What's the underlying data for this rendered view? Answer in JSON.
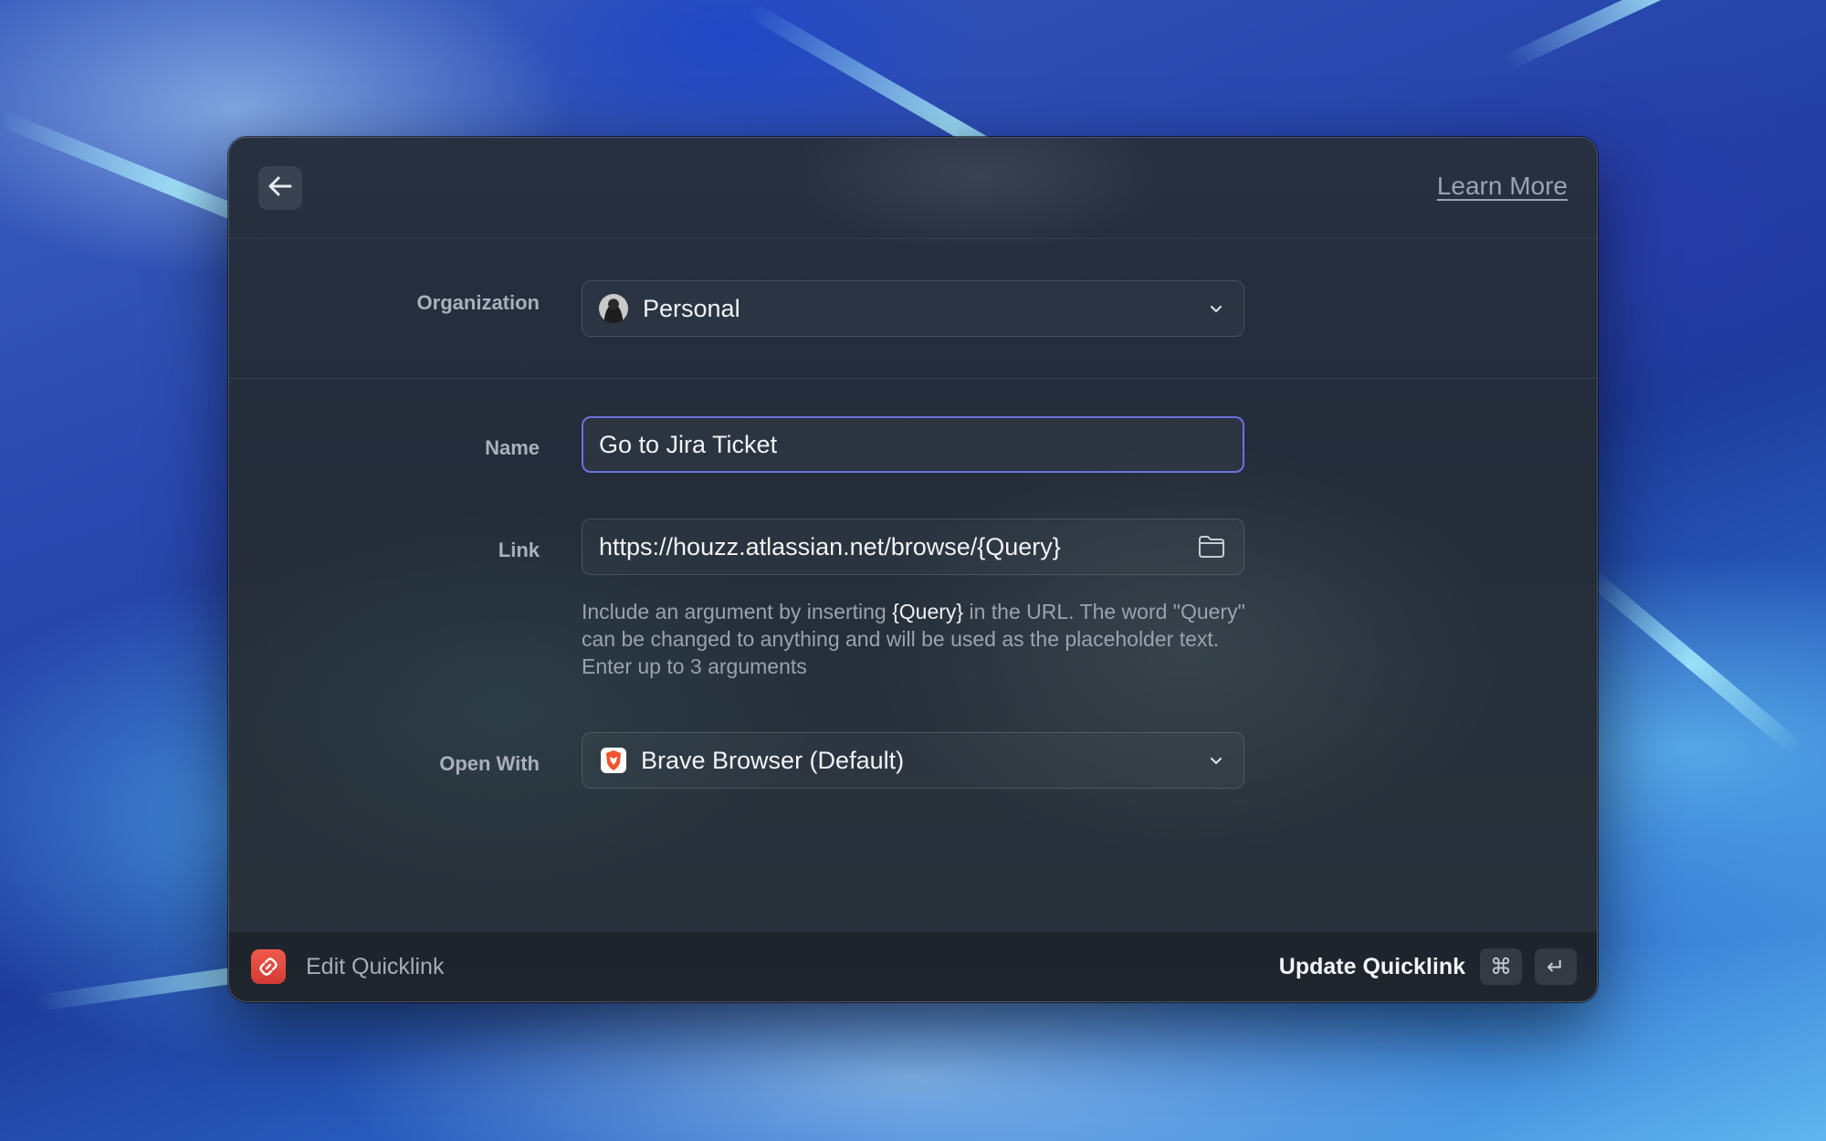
{
  "topbar": {
    "back_icon": "arrow-left-icon",
    "learn_more_label": "Learn More"
  },
  "form": {
    "organization": {
      "label": "Organization",
      "value": "Personal",
      "icon": "avatar"
    },
    "name": {
      "label": "Name",
      "value": "Go to Jira Ticket"
    },
    "link": {
      "label": "Link",
      "value": "https://houzz.atlassian.net/browse/{Query}",
      "icon": "folder-icon",
      "help_prefix": "Include an argument by inserting ",
      "help_highlight": "{Query}",
      "help_suffix": " in the URL. The word \"Query\" can be changed to anything and will be used as the placeholder text. Enter up to 3 arguments"
    },
    "open_with": {
      "label": "Open With",
      "value": "Brave Browser (Default)",
      "icon": "brave-browser-icon"
    }
  },
  "footer": {
    "icon": "link-icon",
    "title": "Edit Quicklink",
    "action_label": "Update Quicklink",
    "shortcut_keys": [
      "⌘",
      "↵"
    ]
  },
  "colors": {
    "accent_focus": "#6b72e0",
    "footer_icon": "#e04a40"
  }
}
